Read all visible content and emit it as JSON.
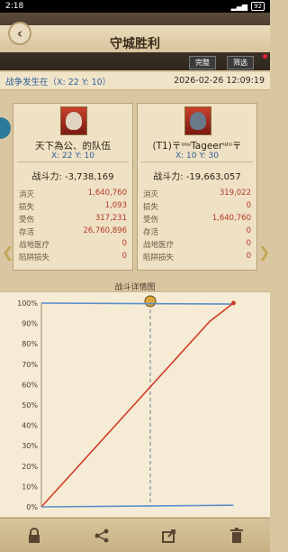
{
  "status": {
    "time": "2:18",
    "battery": "92"
  },
  "header": {
    "title": "守城胜利",
    "back": "‹"
  },
  "tabs": {
    "full": "完整",
    "filter": "筛选"
  },
  "location": {
    "label": "战争发生在（X: 22 Y: 10）",
    "datetime": "2026-02-26  12:09:19"
  },
  "left_player": {
    "name": "天下為公、的队伍",
    "coord": "X: 22 Y: 10",
    "power": "战斗力: -3,738,169",
    "stats": [
      {
        "label": "消灭",
        "value": "1,640,760"
      },
      {
        "label": "损失",
        "value": "1,093"
      },
      {
        "label": "受伤",
        "value": "317,231"
      },
      {
        "label": "存活",
        "value": "26,760,896"
      },
      {
        "label": "战地医疗",
        "value": "0"
      },
      {
        "label": "陷阱损失",
        "value": "0"
      }
    ]
  },
  "right_player": {
    "name": "(T1)〒ᵘᵚTageerᵚᵘ〒",
    "coord": "X: 10 Y: 30",
    "power": "战斗力: -19,663,057",
    "stats": [
      {
        "label": "消灭",
        "value": "319,022"
      },
      {
        "label": "损失",
        "value": "0"
      },
      {
        "label": "受伤",
        "value": "1,640,760"
      },
      {
        "label": "存活",
        "value": "0"
      },
      {
        "label": "战地医疗",
        "value": "0"
      },
      {
        "label": "陷阱损失",
        "value": "0"
      }
    ]
  },
  "chart_data": {
    "type": "line",
    "title": "战斗详情图",
    "yticks": [
      "100%",
      "90%",
      "80%",
      "70%",
      "60%",
      "50%",
      "40%",
      "30%",
      "20%",
      "10%",
      "0%"
    ],
    "ylim": [
      0,
      100
    ],
    "series": [
      {
        "color": "#5b8fc9",
        "points": [
          [
            0,
            100
          ],
          [
            0.97,
            99.5
          ]
        ]
      },
      {
        "color": "#d23c28",
        "points": [
          [
            0,
            0
          ],
          [
            0.85,
            91
          ],
          [
            0.97,
            100
          ]
        ]
      },
      {
        "color": "#5b8fc9",
        "points": [
          [
            0,
            0
          ],
          [
            0.97,
            0.8
          ]
        ]
      }
    ]
  },
  "colors": {
    "accent_blue": "#2f5f9a",
    "stat_red": "#b23a2a"
  },
  "bottom_icons": [
    "lock-icon",
    "share-icon",
    "export-icon",
    "trash-icon"
  ]
}
